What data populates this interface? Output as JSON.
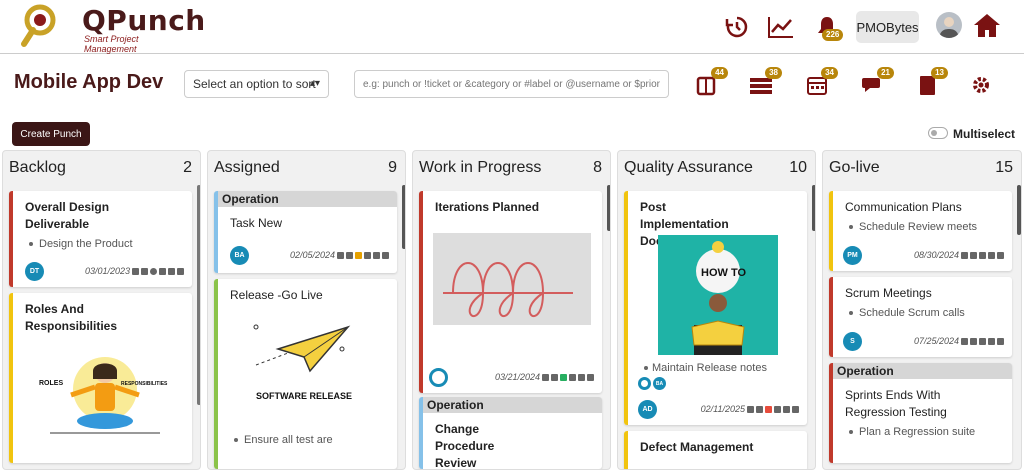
{
  "app": {
    "name": "QPunch",
    "tagline": "Smart Project Management"
  },
  "header": {
    "notifications_count": "226",
    "user_label": "PMOBytes"
  },
  "project": {
    "title": "Mobile App Dev"
  },
  "sort": {
    "placeholder": "Select an option to sort"
  },
  "search": {
    "placeholder": "e.g: punch or !ticket or &category or #label or @username or $priority"
  },
  "tools": [
    {
      "name": "board-icon",
      "count": "44"
    },
    {
      "name": "list-icon",
      "count": "38"
    },
    {
      "name": "calendar-icon",
      "count": "34"
    },
    {
      "name": "chat-icon",
      "count": "21"
    },
    {
      "name": "notebook-icon",
      "count": "13"
    },
    {
      "name": "settings-icon",
      "count": ""
    }
  ],
  "actions": {
    "create_label": "Create Punch",
    "multiselect_label": "Multiselect"
  },
  "colors": {
    "brand": "#4a1a1a",
    "accent": "#7a1212",
    "badge": "#b8860b",
    "avatar": "#178bb5"
  },
  "columns": [
    {
      "title": "Backlog",
      "count": "2",
      "cards": [
        {
          "group": "",
          "title": "Overall Design Deliverable",
          "sub": "Design the Product",
          "avatar": "DT",
          "date": "03/01/2023",
          "stripe": "#c0392b"
        },
        {
          "group": "",
          "title": "Roles And Responsibilities",
          "image_text_left": "ROLES",
          "image_text_right": "RESPONSIBILITIES",
          "stripe": "#f1c40f"
        }
      ]
    },
    {
      "title": "Assigned",
      "count": "9",
      "cards": [
        {
          "group": "Operation",
          "title": "Task New",
          "avatar": "BA",
          "date": "02/05/2024",
          "stripe": "#85c1e9"
        },
        {
          "group": "",
          "title": "Release -Go Live",
          "image_text": "SOFTWARE RELEASE",
          "sub": "Ensure all test are",
          "stripe": "#8bc34a"
        }
      ]
    },
    {
      "title": "Work in Progress",
      "count": "8",
      "cards": [
        {
          "group": "",
          "title": "Iterations Planned",
          "date": "03/21/2024",
          "stripe": "#c0392b"
        },
        {
          "group": "Operation",
          "title": "Change Procedure Review",
          "stripe": "#85c1e9"
        }
      ]
    },
    {
      "title": "Quality Assurance",
      "count": "10",
      "cards": [
        {
          "group": "",
          "title": "Post Implementation Documents",
          "image_text": "HOW TO",
          "sub": "Maintain Release notes",
          "avatar": "AD",
          "avatar2": "BA",
          "date": "02/11/2025",
          "stripe": "#f1c40f"
        },
        {
          "group": "",
          "title": "Defect Management",
          "stripe": "#f1c40f"
        }
      ]
    },
    {
      "title": "Go-live",
      "count": "15",
      "cards": [
        {
          "group": "",
          "title": "Communication Plans",
          "sub": "Schedule Review meets",
          "avatar": "PM",
          "date": "08/30/2024",
          "stripe": "#f1c40f"
        },
        {
          "group": "",
          "title": "Scrum Meetings",
          "sub": "Schedule Scrum calls",
          "avatar": "S",
          "date": "07/25/2024",
          "stripe": "#c0392b"
        },
        {
          "group": "Operation",
          "title": "Sprints Ends With Regression Testing",
          "sub": "Plan a Regression suite",
          "stripe": "#c0392b"
        }
      ]
    }
  ]
}
